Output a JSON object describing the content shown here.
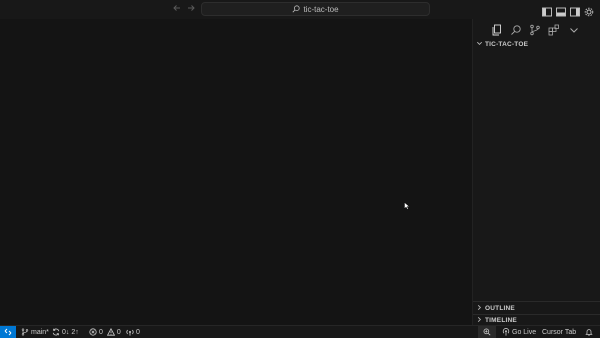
{
  "titlebar": {
    "back_icon": "arrow-left-icon",
    "forward_icon": "arrow-right-icon",
    "search_text": "tic-tac-toe",
    "layout_icons": [
      "toggle-primary-sidebar-icon",
      "toggle-panel-icon",
      "toggle-secondary-sidebar-icon",
      "customize-layout-icon"
    ]
  },
  "sidebar": {
    "tabs": [
      "explorer-icon",
      "search-icon",
      "source-control-icon",
      "extensions-icon",
      "more-chevron-icon"
    ],
    "folder_title": "TIC-TAC-TOE",
    "outline_title": "OUTLINE",
    "timeline_title": "TIMELINE"
  },
  "statusbar": {
    "branch": "main*",
    "sync": "0↓ 2↑",
    "errors": "0",
    "warnings": "0",
    "ports": "0",
    "go_live": "Go Live",
    "cursor_tab": "Cursor Tab",
    "colors": {
      "remote": "#0078d4"
    }
  }
}
